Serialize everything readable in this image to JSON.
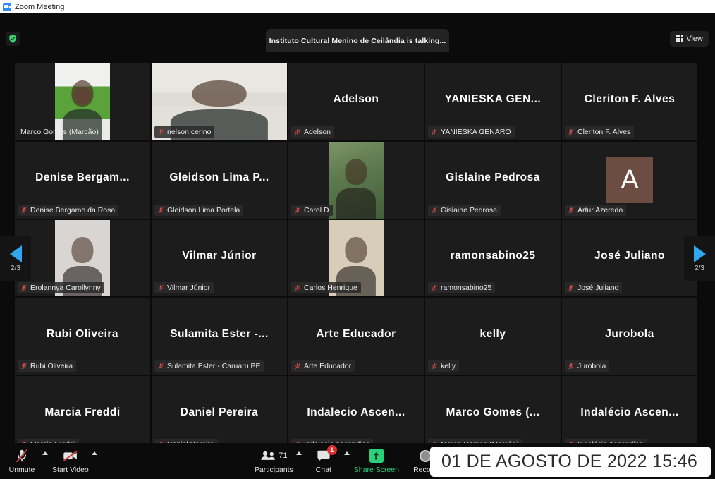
{
  "window": {
    "title": "Zoom Meeting",
    "app_icon": "zoom-camera-icon"
  },
  "topbar": {
    "encryption_icon": "shield-check-icon",
    "encryption_color": "#3bd16f",
    "talking_banner": "Instituto Cultural Menino de Ceilândia is talking...",
    "view_button": {
      "label": "View",
      "icon": "grid-view-icon"
    }
  },
  "navigation": {
    "prev": {
      "icon": "chevron-left-icon",
      "pager": "2/3"
    },
    "next": {
      "icon": "chevron-right-icon",
      "pager": "2/3"
    }
  },
  "gallery": {
    "columns": 5,
    "rows": 5,
    "tiles": [
      {
        "display_name": "Marco Gomes (Marcão)",
        "label": "Marco Gomes (Marcão)",
        "muted": false,
        "media": "video",
        "media_style": "vid-marco",
        "label_plain": true
      },
      {
        "display_name": "nelson cerino",
        "label": "nelson cerino",
        "muted": true,
        "media": "video",
        "media_style": "vid-nelson",
        "media_wide": true
      },
      {
        "display_name": "Adelson",
        "label": "Adelson",
        "muted": true,
        "media": "none"
      },
      {
        "display_name": "YANIESKA  GEN...",
        "label": "YANIESKA GENARO",
        "muted": true,
        "media": "none"
      },
      {
        "display_name": "Cleriton F. Alves",
        "label": "Cleriton F. Alves",
        "muted": true,
        "media": "none"
      },
      {
        "display_name": "Denise  Bergam...",
        "label": "Denise Bergamo da Rosa",
        "muted": true,
        "media": "none"
      },
      {
        "display_name": "Gleidson  Lima  P...",
        "label": "Gleidson Lima Portela",
        "muted": true,
        "media": "none"
      },
      {
        "display_name": "Carol D",
        "label": "Carol D",
        "muted": true,
        "media": "photo",
        "media_style": "photo-carol"
      },
      {
        "display_name": "Gislaine Pedrosa",
        "label": "Gislaine Pedrosa",
        "muted": true,
        "media": "none"
      },
      {
        "display_name": "Artur Azeredo",
        "label": "Artur Azeredo",
        "muted": true,
        "media": "initial",
        "initial": "A",
        "initial_color": "#6d4c41"
      },
      {
        "display_name": "Erolannya Carollynny",
        "label": "Erolannya Carollynny",
        "muted": true,
        "media": "photo",
        "media_style": "photo-erolannya"
      },
      {
        "display_name": "Vilmar Júnior",
        "label": "Vilmar Júnior",
        "muted": true,
        "media": "none"
      },
      {
        "display_name": "Carlos Henrique",
        "label": "Carlos Henrique",
        "muted": true,
        "media": "photo",
        "media_style": "photo-carlos"
      },
      {
        "display_name": "ramonsabino25",
        "label": "ramonsabino25",
        "muted": true,
        "media": "none"
      },
      {
        "display_name": "José Juliano",
        "label": "José Juliano",
        "muted": true,
        "media": "none"
      },
      {
        "display_name": "Rubi Oliveira",
        "label": "Rubi Oliveira",
        "muted": true,
        "media": "none"
      },
      {
        "display_name": "Sulamita  Ester  -...",
        "label": "Sulamita Ester - Caruaru PE",
        "muted": true,
        "media": "none"
      },
      {
        "display_name": "Arte Educador",
        "label": "Arte Educador",
        "muted": true,
        "media": "none"
      },
      {
        "display_name": "kelly",
        "label": "kelly",
        "muted": true,
        "media": "none"
      },
      {
        "display_name": "Jurobola",
        "label": "Jurobola",
        "muted": true,
        "media": "none"
      },
      {
        "display_name": "Marcia Freddi",
        "label": "Marcia Freddi",
        "muted": true,
        "media": "none"
      },
      {
        "display_name": "Daniel Pereira",
        "label": "Daniel Pereira",
        "muted": true,
        "media": "none"
      },
      {
        "display_name": "Indalecio  Ascen...",
        "label": "Indalecio Ascendino",
        "muted": true,
        "media": "none"
      },
      {
        "display_name": "Marco  Gomes  (...",
        "label": "Marco Gomes (Marcão)",
        "muted": true,
        "media": "none"
      },
      {
        "display_name": "Indalécio  Ascen...",
        "label": "Indalécio Ascendino",
        "muted": true,
        "media": "none"
      }
    ]
  },
  "toolbar": {
    "mute": {
      "label": "Unmute",
      "icon": "microphone-off-icon",
      "caret": true
    },
    "video": {
      "label": "Start Video",
      "icon": "camera-off-icon",
      "caret": true
    },
    "participants": {
      "label": "Participants",
      "icon": "participants-icon",
      "count": "71",
      "caret": true
    },
    "chat": {
      "label": "Chat",
      "icon": "chat-bubble-icon",
      "badge": "1",
      "caret": true
    },
    "share": {
      "label": "Share Screen",
      "icon": "share-screen-icon",
      "accent_color": "#2bd07c"
    },
    "record": {
      "label": "Record",
      "icon": "record-circle-icon"
    }
  },
  "overlay": {
    "timestamp": "01 DE AGOSTO DE 2022 15:46"
  }
}
